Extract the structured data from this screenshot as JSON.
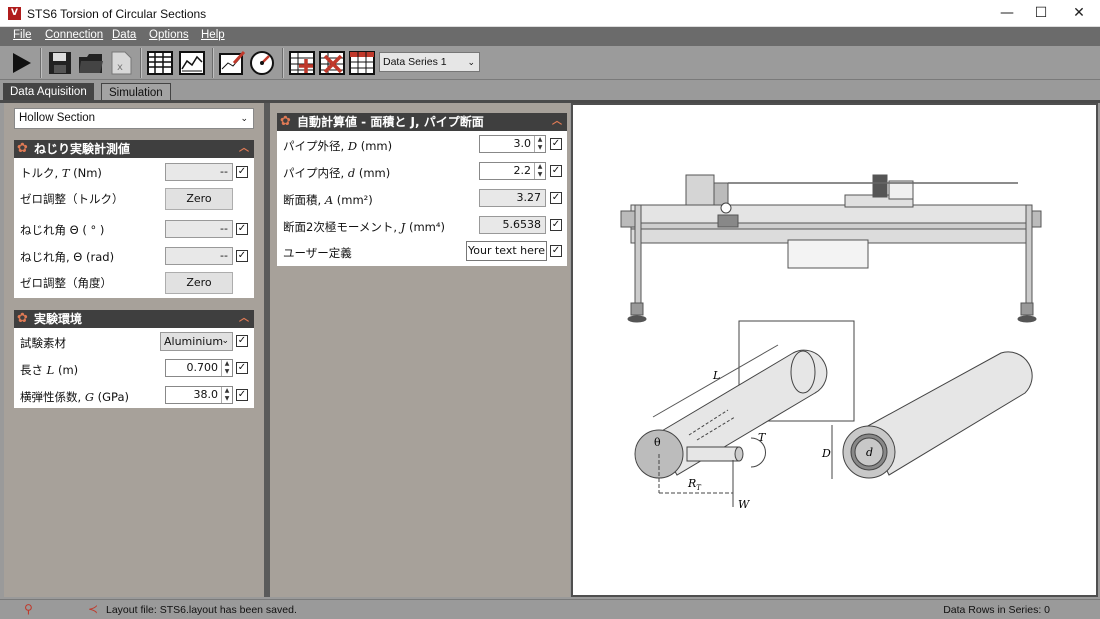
{
  "window": {
    "title": "STS6 Torsion of Circular Sections",
    "app_icon_glyph": "V",
    "minimize_glyph": "—",
    "maximize_glyph": "☐",
    "close_glyph": "✕"
  },
  "menu": [
    "File",
    "Connection",
    "Data",
    "Options",
    "Help"
  ],
  "toolbar": {
    "icons": [
      "run-icon",
      "save-icon",
      "open-folder-icon",
      "excel-export-icon",
      "table-icon",
      "graph-icon",
      "chart-edit-icon",
      "gauge-icon",
      "add-table-icon",
      "delete-table-icon",
      "table-settings-icon"
    ],
    "series_select": "Data Series 1"
  },
  "tabs": [
    "Data Aquisition",
    "Simulation"
  ],
  "left": {
    "section_select": "Hollow Section",
    "group1": {
      "title": "ねじり実験計測値",
      "torque_label": "トルク, ",
      "torque_sym": "T",
      "torque_unit": " (Nm)",
      "torque_value": "--",
      "zero_torque_label": "ゼロ調整（トルク）",
      "zero_button": "Zero",
      "angle_deg_label": "ねじれ角 Θ ( ° )",
      "angle_deg_value": "--",
      "angle_rad_label": "ねじれ角, Θ (rad)",
      "angle_rad_value": "--",
      "zero_angle_label": "ゼロ調整（角度）"
    },
    "group2": {
      "title": "実験環境",
      "material_label": "試験素材",
      "material_value": "Aluminium",
      "length_label": "長さ ",
      "length_sym": "L",
      "length_unit": " (m)",
      "length_value": "0.700",
      "modulus_label": "横弾性係数, ",
      "modulus_sym": "G",
      "modulus_unit": " (GPa)",
      "modulus_value": "38.0"
    }
  },
  "mid": {
    "title": "自動計算値 - 面積と J, パイプ断面",
    "outer_label": "パイプ外径, ",
    "outer_sym": "D",
    "outer_unit": " (mm)",
    "outer_value": "3.0",
    "inner_label": "パイプ内径, ",
    "inner_sym": "d",
    "inner_unit": " (mm)",
    "inner_value": "2.2",
    "area_label": "断面積, ",
    "area_sym": "A",
    "area_unit": " (mm²)",
    "area_value": "3.27",
    "polar_label": "断面2次極モーメント, ",
    "polar_sym": "J",
    "polar_unit": " (mm⁴)",
    "polar_value": "5.6538",
    "user_label": "ユーザー定義",
    "user_value": "Your text here"
  },
  "diagram": {
    "L": "L",
    "T": "T",
    "D": "D",
    "d": "d",
    "theta": "θ",
    "RT": "R",
    "RT_sub": "T",
    "W": "W"
  },
  "status": {
    "usb_icon": "usb-icon",
    "share_icon": "share-icon",
    "message": "Layout file: STS6.layout has been saved.",
    "rows": "Data Rows in Series: 0"
  }
}
